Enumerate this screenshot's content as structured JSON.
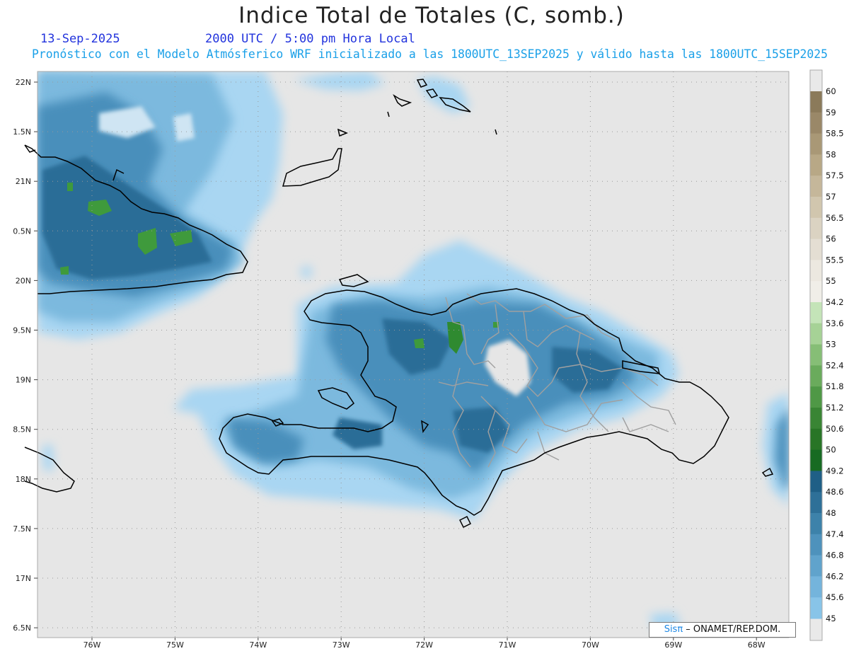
{
  "header": {
    "title": "Indice Total de Totales (C, somb.)",
    "date": "13-Sep-2025",
    "time": "2000 UTC / 5:00 pm Hora Local",
    "subtitle": "Pronóstico con el Modelo Atmósferico WRF inicializado a las 1800UTC_13SEP2025 y válido hasta las  1800UTC_15SEP2025"
  },
  "map": {
    "background_color": "#e6e6e6",
    "coastline_color": "#000000",
    "province_border_color": "#a0a0a0",
    "grid_color": "#9a9a9a",
    "lon_labels": [
      "76W",
      "75W",
      "74W",
      "73W",
      "72W",
      "71W",
      "70W",
      "69W",
      "68W"
    ],
    "lat_labels": [
      "22N",
      "1.5N",
      "21N",
      "0.5N",
      "20N",
      "9.5N",
      "19N",
      "8.5N",
      "18N",
      "7.5N",
      "17N",
      "6.5N"
    ]
  },
  "legend": {
    "levels": [
      "60",
      "59",
      "58.5",
      "58",
      "57.5",
      "57",
      "56.5",
      "56",
      "55.5",
      "55",
      "54.2",
      "53.6",
      "53",
      "52.4",
      "51.8",
      "51.2",
      "50.6",
      "50",
      "49.2",
      "48.6",
      "48",
      "47.4",
      "46.8",
      "46.2",
      "45.6",
      "45"
    ],
    "colors": [
      "#8b7a5a",
      "#9a8868",
      "#a99876",
      "#b8a886",
      "#c5b79a",
      "#d1c6ae",
      "#dbd3c2",
      "#e4ded3",
      "#ece8e0",
      "#f0eee8",
      "#c4e4b8",
      "#a6d296",
      "#86be76",
      "#6aab5c",
      "#4f9846",
      "#398534",
      "#287526",
      "#176b22",
      "#1f5f86",
      "#2e7098",
      "#3d82aa",
      "#4e92bc",
      "#60a3cc",
      "#74b4dc",
      "#88c4e8",
      "#a2d4f2"
    ]
  },
  "credit": {
    "logo": "Sisπ",
    "text": " –  ONAMET/REP.DOM."
  }
}
